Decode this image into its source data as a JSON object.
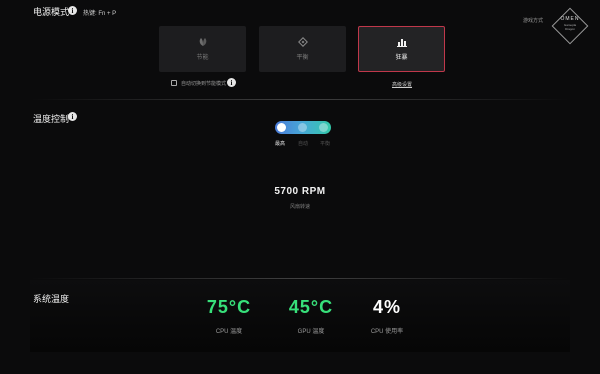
{
  "power_mode": {
    "title": "电源模式",
    "hotkey": "热键: Fn + P",
    "modes": [
      {
        "label": "节能",
        "icon": "leaf-icon",
        "active": false
      },
      {
        "label": "平衡",
        "icon": "balance-diamond-icon",
        "active": false
      },
      {
        "label": "狂暴",
        "icon": "performance-bars-icon",
        "active": true
      }
    ],
    "auto_switch_label": "自动切换到节能模式",
    "advanced_link": "高级设置"
  },
  "brand": {
    "small_text": "游戏方式",
    "logo_text": "OMEN",
    "logo_sub1": "Gamepla",
    "logo_sub2": "Dragon"
  },
  "temp_control": {
    "title": "温度控制",
    "options": [
      "最高",
      "自动",
      "平衡"
    ],
    "selected_index": 0,
    "rpm_value": "5700 RPM",
    "rpm_label": "风扇转速"
  },
  "system_temp": {
    "title": "系统温度",
    "readings": [
      {
        "value": "75°C",
        "label": "CPU 温度",
        "color": "#37e07a"
      },
      {
        "value": "45°C",
        "label": "GPU 温度",
        "color": "#37e07a"
      },
      {
        "value": "4%",
        "label": "CPU 使用率",
        "color": "#ffffff"
      }
    ]
  }
}
